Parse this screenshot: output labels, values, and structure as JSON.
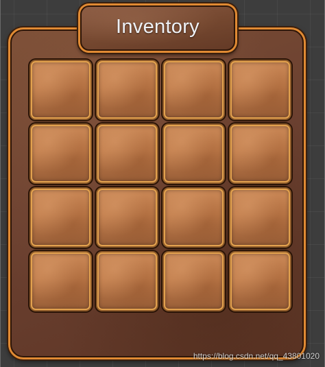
{
  "inventory": {
    "title": "Inventory",
    "grid": {
      "rows": 4,
      "columns": 4
    },
    "slots": [
      {
        "index": 1,
        "item": null
      },
      {
        "index": 2,
        "item": null
      },
      {
        "index": 3,
        "item": null
      },
      {
        "index": 4,
        "item": null
      },
      {
        "index": 5,
        "item": null
      },
      {
        "index": 6,
        "item": null
      },
      {
        "index": 7,
        "item": null
      },
      {
        "index": 8,
        "item": null
      },
      {
        "index": 9,
        "item": null
      },
      {
        "index": 10,
        "item": null
      },
      {
        "index": 11,
        "item": null
      },
      {
        "index": 12,
        "item": null
      },
      {
        "index": 13,
        "item": null
      },
      {
        "index": 14,
        "item": null
      },
      {
        "index": 15,
        "item": null
      },
      {
        "index": 16,
        "item": null
      }
    ]
  },
  "watermark": "https://blog.csdn.net/qq_43801020",
  "colors": {
    "background": "#3d3d3d",
    "frame_orange": "#e08a33",
    "panel_brown": "#6b4030",
    "slot_tan": "#c07c4b",
    "title_text": "#eef1f6"
  }
}
